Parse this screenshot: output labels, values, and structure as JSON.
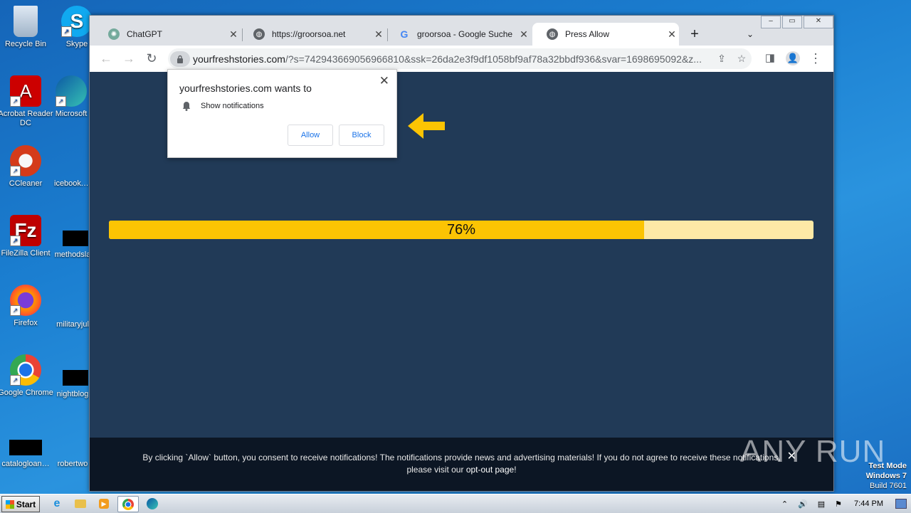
{
  "desktop": {
    "icons": [
      {
        "label": "Recycle Bin"
      },
      {
        "label": "Skype"
      },
      {
        "label": "Acrobat Reader DC"
      },
      {
        "label": "Microsoft"
      },
      {
        "label": "CCleaner"
      },
      {
        "label": "icebook.…"
      },
      {
        "label": "FileZilla Client"
      },
      {
        "label": "methodsla"
      },
      {
        "label": "Firefox"
      },
      {
        "label": "militaryjul"
      },
      {
        "label": "Google Chrome"
      },
      {
        "label": "nightblog"
      },
      {
        "label": "catalogloan…"
      },
      {
        "label": "robertwo"
      }
    ]
  },
  "browser": {
    "tabs": [
      {
        "title": "ChatGPT",
        "active": false
      },
      {
        "title": "https://groorsoa.net",
        "active": false
      },
      {
        "title": "groorsoa - Google Suche",
        "active": false
      },
      {
        "title": "Press Allow",
        "active": true
      }
    ],
    "new_tab": "+",
    "address": {
      "host": "yourfreshstories.com",
      "path": "/?s=742943669056966810&ssk=26da2e3f9df1058bf9af78a32bbdf936&svar=1698695092&z..."
    }
  },
  "prompt": {
    "heading": "yourfreshstories.com wants to",
    "permission": "Show notifications",
    "allow": "Allow",
    "block": "Block"
  },
  "progress": {
    "percent_label": "76%",
    "fraction": 0.76
  },
  "consent": {
    "text_line1": "By clicking `Allow` button, you consent to receive notifications! The notifications provide news and advertising materials! If you do not agree to receive these notifications,",
    "text_before_link": "please visit our ",
    "link": "opt-out page",
    "text_after_link": "!"
  },
  "watermark": "ANY RUN",
  "test_mode": {
    "line1": "Test Mode",
    "line2": "Windows 7",
    "line3": "Build 7601"
  },
  "taskbar": {
    "start_label": "Start",
    "clock": "7:44 PM"
  },
  "colors": {
    "page_bg": "#213a57",
    "progress_fill": "#fcc403",
    "progress_track": "#fde9a6",
    "arrow": "#fcc403"
  }
}
